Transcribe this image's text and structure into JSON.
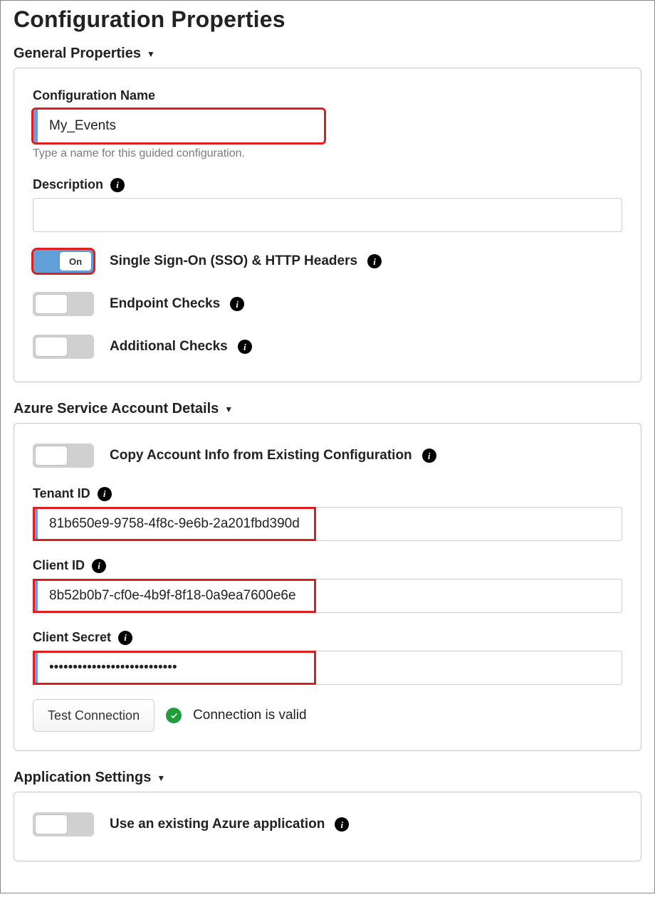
{
  "page_title": "Configuration Properties",
  "sections": {
    "general": {
      "header": "General Properties",
      "config_name": {
        "label": "Configuration Name",
        "value": "My_Events",
        "help": "Type a name for this guided configuration."
      },
      "description": {
        "label": "Description",
        "value": ""
      },
      "toggles": {
        "sso": {
          "label": "Single Sign-On (SSO) & HTTP Headers",
          "state": "on",
          "knob_text": "On"
        },
        "endpoint": {
          "label": "Endpoint Checks",
          "state": "off"
        },
        "additional": {
          "label": "Additional Checks",
          "state": "off"
        }
      }
    },
    "azure": {
      "header": "Azure Service Account Details",
      "copy_toggle": {
        "label": "Copy Account Info from Existing Configuration",
        "state": "off"
      },
      "tenant_id": {
        "label": "Tenant ID",
        "value": "81b650e9-9758-4f8c-9e6b-2a201fbd390d"
      },
      "client_id": {
        "label": "Client ID",
        "value": "8b52b0b7-cf0e-4b9f-8f18-0a9ea7600e6e"
      },
      "client_secret": {
        "label": "Client Secret",
        "value": "•••••••••••••••••••••••••••"
      },
      "test_button": "Test Connection",
      "connection_status": "Connection is valid"
    },
    "app_settings": {
      "header": "Application Settings",
      "existing_toggle": {
        "label": "Use an existing Azure application",
        "state": "off"
      }
    }
  }
}
